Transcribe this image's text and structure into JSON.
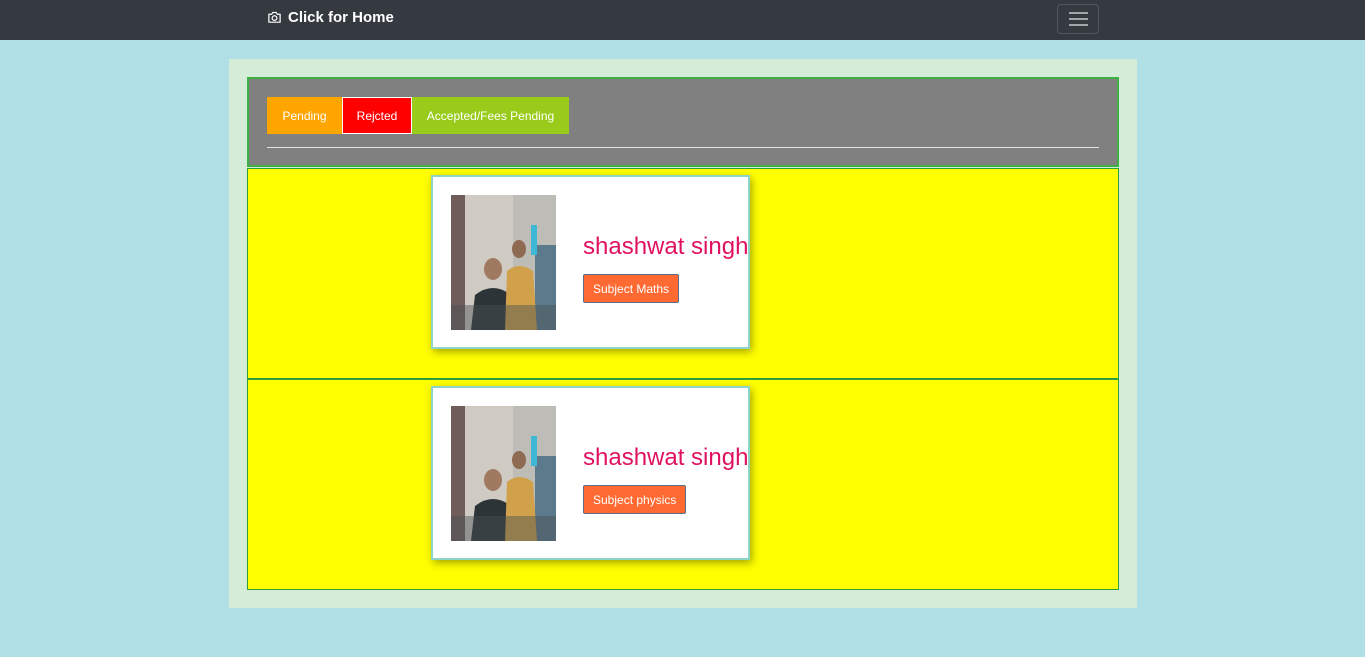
{
  "navbar": {
    "brand": "Click for Home",
    "brand_icon": "camera-icon",
    "toggler_icon": "hamburger-menu-icon"
  },
  "tabs": [
    {
      "label": "Pending",
      "color": "#ffa500"
    },
    {
      "label": "Rejcted",
      "color": "#ff0000"
    },
    {
      "label": "Accepted/Fees Pending",
      "color": "#99cc1a"
    }
  ],
  "requests": [
    {
      "name": "shashwat singh",
      "subject_label": "Subject Maths"
    },
    {
      "name": "shashwat singh",
      "subject_label": "Subject physics"
    }
  ],
  "colors": {
    "page_bg": "#b0e0e6",
    "row_bg": "#ffff00",
    "name_color": "#e0115f",
    "subject_button": "#ff6a33",
    "navbar_bg": "#343a40"
  }
}
